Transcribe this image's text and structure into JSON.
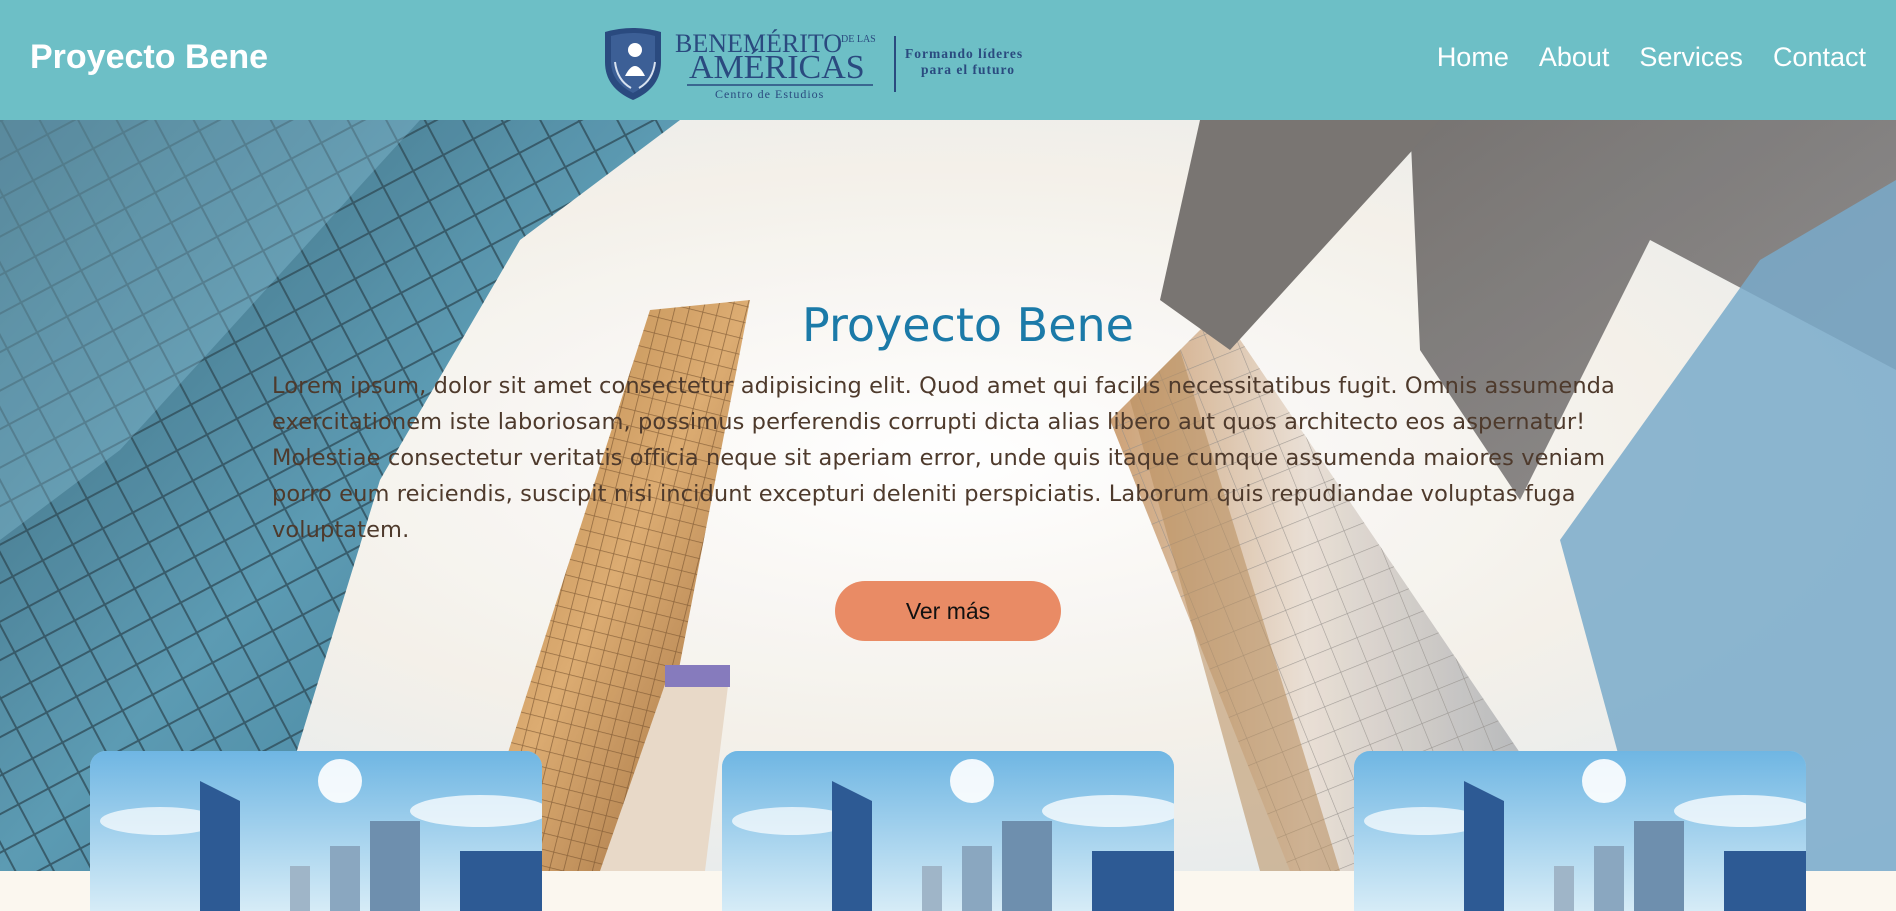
{
  "header": {
    "site_title": "Proyecto Bene",
    "logo": {
      "line1": "BENEMÉRITO",
      "de_las": "DE LAS",
      "line2": "AMÉRICAS",
      "centro": "Centro de Estudios",
      "tagline1": "Formando líderes",
      "tagline2": "para el futuro"
    },
    "nav": [
      "Home",
      "About",
      "Services",
      "Contact"
    ]
  },
  "hero": {
    "title": "Proyecto Bene",
    "text": "Lorem ipsum, dolor sit amet consectetur adipisicing elit. Quod amet qui facilis necessitatibus fugit. Omnis assumenda exercitationem iste laboriosam, possimus perferendis corrupti dicta alias libero aut quos architecto eos aspernatur! Molestiae consectetur veritatis officia neque sit aperiam error, unde quis itaque cumque assumenda maiores veniam porro eum reiciendis, suscipit nisi incidunt excepturi deleniti perspiciatis. Laborum quis repudiandae voluptas fuga voluptatem.",
    "button_label": "Ver más"
  },
  "colors": {
    "header_bg": "#6dbfc6",
    "title_blue": "#1b7aa8",
    "button": "#e98b65",
    "text_brown": "#4e3a2c"
  }
}
